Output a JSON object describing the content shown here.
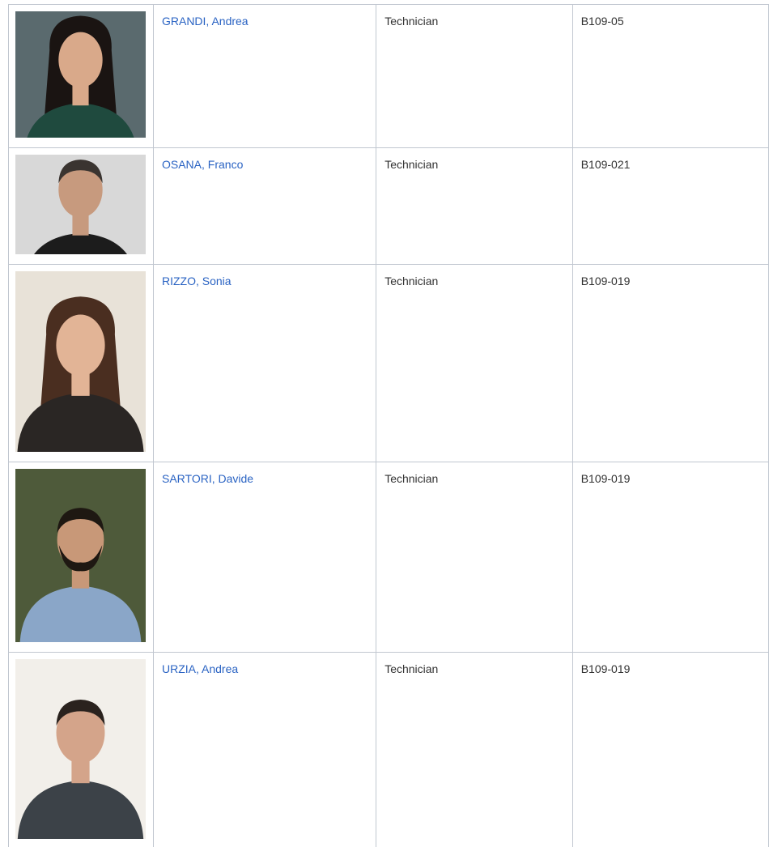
{
  "people": [
    {
      "name": "GRANDI, Andrea",
      "role": "Technician",
      "room": "B109-05",
      "photo": {
        "icon": "portrait-woman-dark-hair",
        "bg": "#5a6a6e",
        "hair": "#1a1412",
        "skin": "#d9a98a",
        "shirt": "#1f4a3e"
      }
    },
    {
      "name": "OSANA, Franco",
      "role": "Technician",
      "room": "B109-021",
      "photo": {
        "icon": "portrait-man-bald",
        "bg": "#d8d8d8",
        "hair": "#3a3430",
        "skin": "#c79a7e",
        "shirt": "#1c1c1c"
      }
    },
    {
      "name": "RIZZO, Sonia",
      "role": "Technician",
      "room": "B109-019",
      "photo": {
        "icon": "portrait-woman-long-hair",
        "bg": "#e8e2d8",
        "hair": "#4a2e20",
        "skin": "#e2b496",
        "shirt": "#2a2624"
      }
    },
    {
      "name": "SARTORI, Davide",
      "role": "Technician",
      "room": "B109-019",
      "photo": {
        "icon": "portrait-man-beard",
        "bg": "#4e5a3a",
        "hair": "#1e1812",
        "skin": "#c89878",
        "shirt": "#8aa6c8"
      }
    },
    {
      "name": "URZIA, Andrea",
      "role": "Technician",
      "room": "B109-019",
      "photo": {
        "icon": "portrait-man-short-hair",
        "bg": "#f2efea",
        "hair": "#2a221e",
        "skin": "#d4a48a",
        "shirt": "#3c4248"
      }
    }
  ]
}
